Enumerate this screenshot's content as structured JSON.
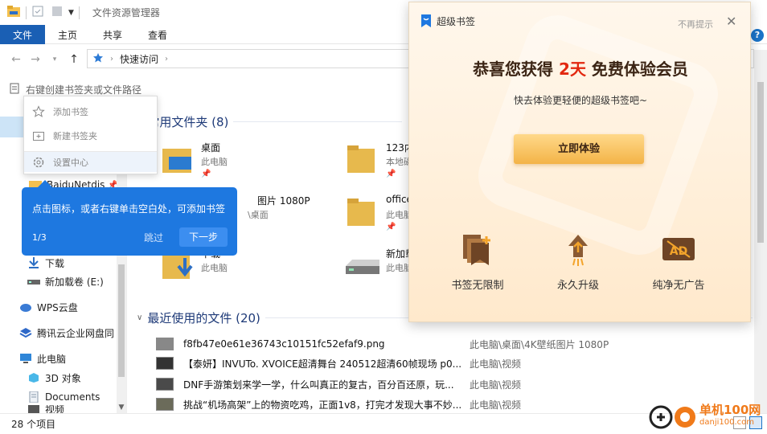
{
  "window": {
    "title": "文件资源管理器"
  },
  "ribbon": {
    "tabs": [
      "文件",
      "主页",
      "共享",
      "查看"
    ],
    "help": "?"
  },
  "address": {
    "crumbs": [
      "快速访问"
    ]
  },
  "bookmark_bar": {
    "hint": "右键创建书签夹或文件路径"
  },
  "sidebar": {
    "items": [
      {
        "label": "BaiduNetdis"
      },
      {
        "label": "下载"
      },
      {
        "label": "新加载卷 (E:)"
      },
      {
        "label": "WPS云盘"
      },
      {
        "label": "腾讯云企业网盘同"
      },
      {
        "label": "此电脑"
      },
      {
        "label": "3D 对象"
      },
      {
        "label": "Documents"
      },
      {
        "label": "视频"
      }
    ]
  },
  "frequent": {
    "title": "常用文件夹 (8)",
    "tiles": [
      {
        "name": "桌面",
        "sub": "此电脑"
      },
      {
        "name": "123内",
        "sub": "本地磁"
      },
      {
        "name": "图片 1080P",
        "sub": "\\桌面"
      },
      {
        "name": "office",
        "sub": "此电脑"
      },
      {
        "name": "下载",
        "sub": "此电脑"
      },
      {
        "name": "新加载",
        "sub": "此电脑"
      }
    ]
  },
  "recent": {
    "title": "最近使用的文件 (20)",
    "rows": [
      {
        "name": "f8fb47e0e61e36743c10151fc52efaf9.png",
        "path": "此电脑\\桌面\\4K壁纸图片 1080P"
      },
      {
        "name": "【泰妍】INVUTo. XVOICE超清舞台 240512超清60帧现场 p0...",
        "path": "此电脑\\视频"
      },
      {
        "name": "DNF手游策划来学一学，什么叫真正的复古，百分百还原，玩...",
        "path": "此电脑\\视频"
      },
      {
        "name": "挑战“机场高架”上的物资吃鸡，正面1v8，打完才发现大事不妙...",
        "path": "此电脑\\视频"
      }
    ]
  },
  "status": {
    "count": "28 个项目"
  },
  "context_menu": {
    "items": [
      "添加书签",
      "新建书签夹",
      "设置中心"
    ]
  },
  "tip": {
    "message": "点击图标，或者右键单击空白处，可添加书签",
    "step": "1/3",
    "skip": "跳过",
    "next": "下一步"
  },
  "promo": {
    "brand": "超级书签",
    "dismiss": "不再提示",
    "headline_pre": "恭喜您获得",
    "headline_days": "2天",
    "headline_post": "免费体验会员",
    "subtitle": "快去体验更轻便的超级书签吧~",
    "cta": "立即体验",
    "features": [
      {
        "label": "书签无限制",
        "icon": "bookmark-stack-icon"
      },
      {
        "label": "永久升级",
        "icon": "rocket-upgrade-icon"
      },
      {
        "label": "纯净无广告",
        "icon": "no-ads-icon"
      }
    ],
    "accent_color": "#e2270f"
  },
  "watermark": {
    "text": "单机100网",
    "url": "danji100.com"
  }
}
